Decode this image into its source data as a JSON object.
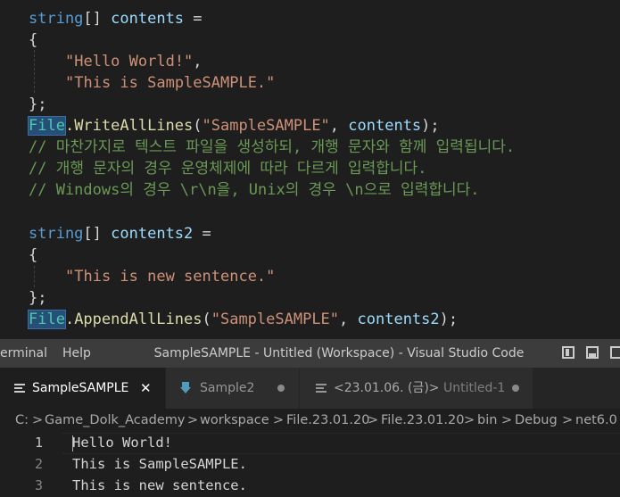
{
  "code_panel": {
    "line1": {
      "type": "string",
      "brackets": "[]",
      "name": "contents",
      "op": "="
    },
    "line2": "{",
    "line3": {
      "value": "\"Hello World!\"",
      "punct": ","
    },
    "line4": {
      "value": "\"This is SampleSAMPLE.\""
    },
    "line5": "};",
    "line6": {
      "cls": "File",
      "method": ".WriteAllLines",
      "open": "(",
      "arg1": "\"SampleSAMPLE\"",
      "sep": ", ",
      "arg2": "contents",
      "close": ");"
    },
    "comment1": "// 마찬가지로 텍스트 파일을 생성하되, 개행 문자와 함께 입력됩니다.",
    "comment2": "// 개행 문자의 경우 운영체제에 따라 다르게 입력합니다.",
    "comment3": "// Windows의 경우 \\r\\n을, Unix의 경우 \\n으로 입력합니다.",
    "line11": {
      "type": "string",
      "brackets": "[]",
      "name": "contents2",
      "op": "="
    },
    "line12": "{",
    "line13": {
      "value": "\"This is new sentence.\""
    },
    "line14": "};",
    "line15": {
      "cls": "File",
      "method": ".AppendAllLines",
      "open": "(",
      "arg1": "\"SampleSAMPLE\"",
      "sep": ", ",
      "arg2": "contents2",
      "close": ");"
    }
  },
  "titlebar": {
    "menu": [
      "erminal",
      "Help"
    ],
    "title": "SampleSAMPLE - Untitled (Workspace) - Visual Studio Code"
  },
  "tabs": [
    {
      "label": "SampleSAMPLE",
      "active": true,
      "close": "✕"
    },
    {
      "label": "Sample2",
      "icon": "download-arrow-icon"
    },
    {
      "label_prefix": "<23.01.06. (금)>",
      "label": "Untitled-1",
      "icon": "lines-icon"
    }
  ],
  "breadcrumb": {
    "items": [
      "C:",
      "Game_Dolk_Academy",
      "workspace",
      "File.23.01.20",
      "File.23.01.20",
      "bin",
      "Debug",
      "net6.0"
    ],
    "separator": ">"
  },
  "editor": {
    "lines": [
      {
        "number": "1",
        "text": "Hello World!"
      },
      {
        "number": "2",
        "text": "This is SampleSAMPLE."
      },
      {
        "number": "3",
        "text": "This is new sentence."
      }
    ]
  },
  "colors": {
    "keyword": "#569cd6",
    "variable": "#9cdcfe",
    "string": "#ce9178",
    "class": "#4ec9b0",
    "function": "#dcdcaa",
    "comment": "#6a9955",
    "editor_bg": "#1e1e1e",
    "titlebar_bg": "#3c3c3c"
  }
}
